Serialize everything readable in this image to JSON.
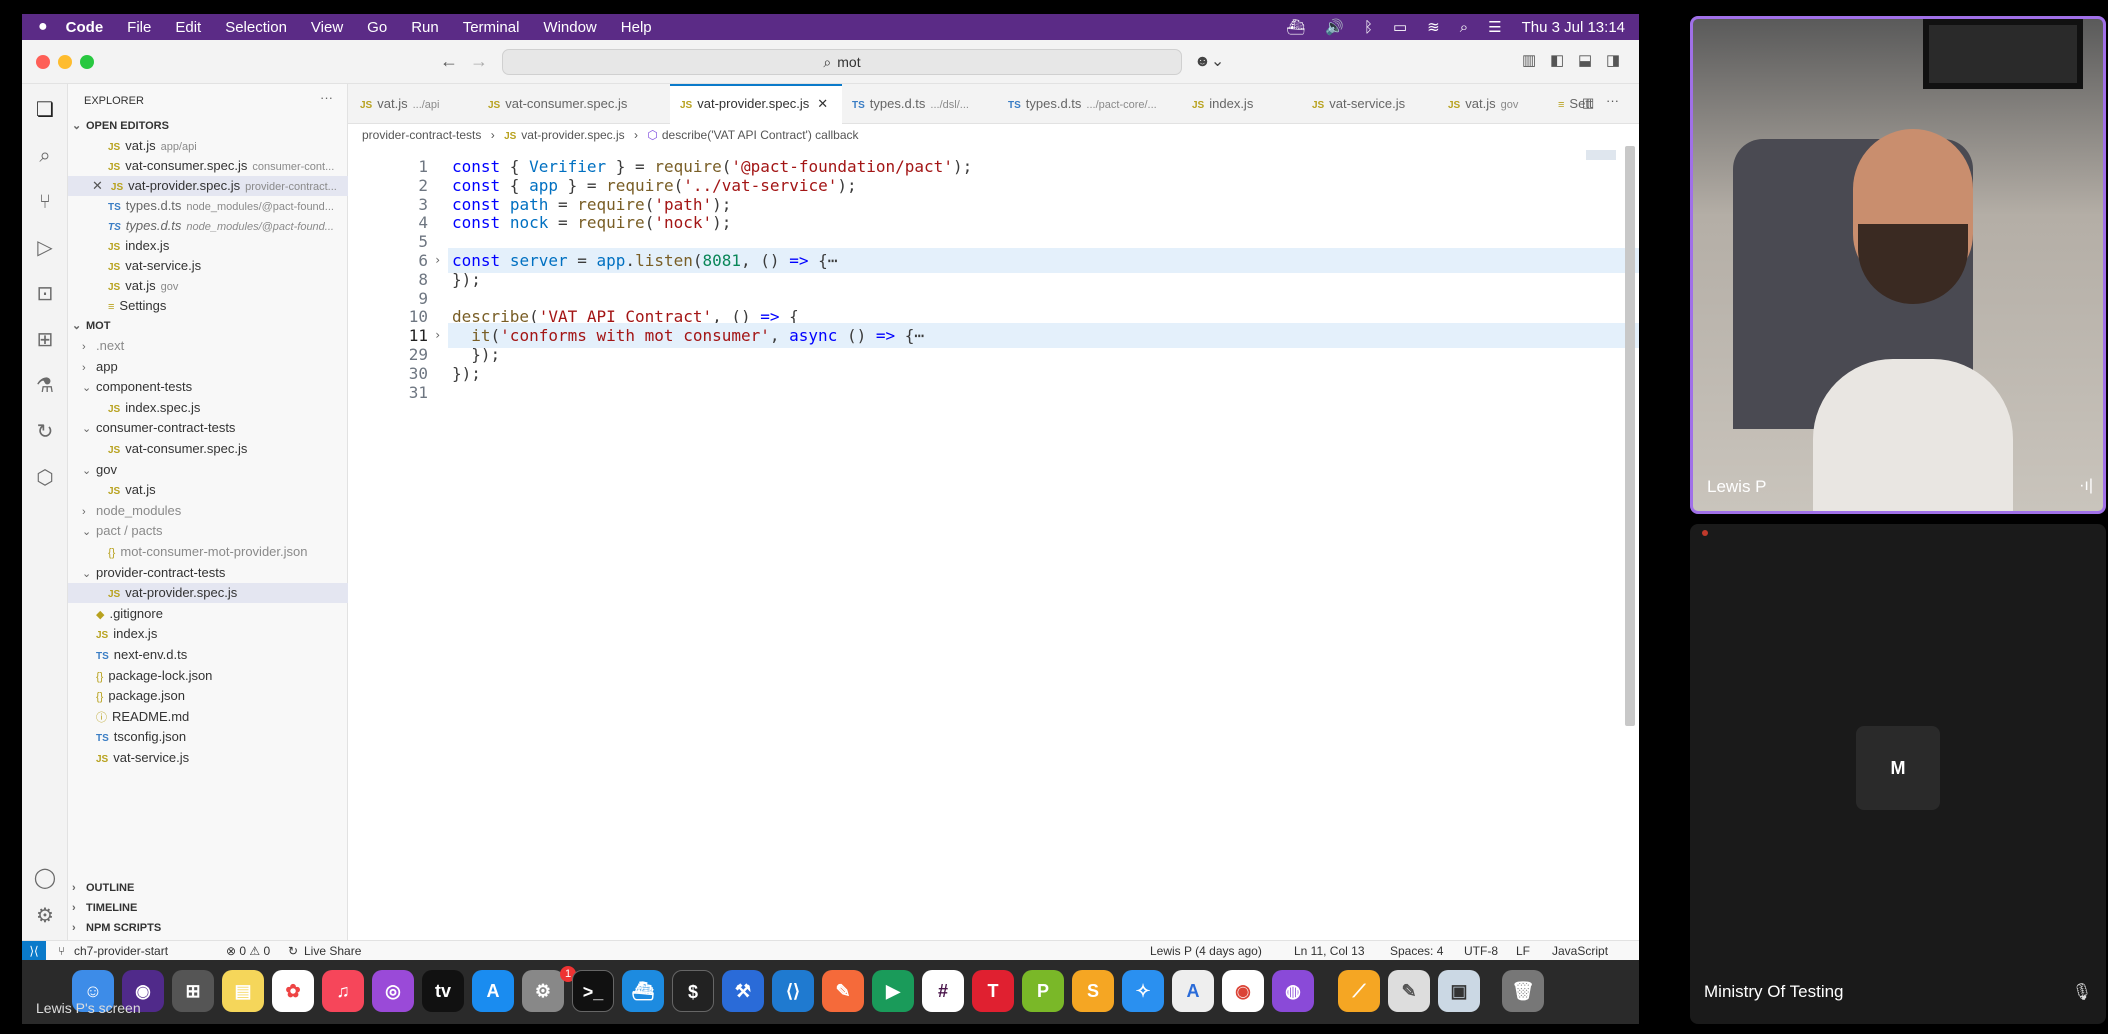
{
  "menubar": {
    "app": "Code",
    "items": [
      "File",
      "Edit",
      "Selection",
      "View",
      "Go",
      "Run",
      "Terminal",
      "Window",
      "Help"
    ],
    "clock": "Thu 3 Jul  13:14"
  },
  "search": {
    "text": "mot"
  },
  "explorer": {
    "title": "EXPLORER",
    "open_editors": "OPEN EDITORS",
    "open_files": [
      {
        "icon": "JS",
        "name": "vat.js",
        "hint": "app/api"
      },
      {
        "icon": "JS",
        "name": "vat-consumer.spec.js",
        "hint": "consumer-cont..."
      },
      {
        "icon": "JS",
        "name": "vat-provider.spec.js",
        "hint": "provider-contract..."
      },
      {
        "icon": "TS",
        "name": "types.d.ts",
        "hint": "node_modules/@pact-found..."
      },
      {
        "icon": "TS",
        "name": "types.d.ts",
        "hint": "node_modules/@pact-found..."
      },
      {
        "icon": "JS",
        "name": "index.js",
        "hint": ""
      },
      {
        "icon": "JS",
        "name": "vat-service.js",
        "hint": ""
      },
      {
        "icon": "JS",
        "name": "vat.js",
        "hint": "gov"
      },
      {
        "icon": "≡",
        "name": "Settings",
        "hint": ""
      }
    ],
    "project": "MOT",
    "tree": [
      {
        "indent": 1,
        "chev": "›",
        "icon": "",
        "name": ".next"
      },
      {
        "indent": 1,
        "chev": "›",
        "icon": "",
        "name": "app"
      },
      {
        "indent": 1,
        "chev": "⌄",
        "icon": "",
        "name": "component-tests"
      },
      {
        "indent": 2,
        "chev": "",
        "icon": "JS",
        "name": "index.spec.js"
      },
      {
        "indent": 1,
        "chev": "⌄",
        "icon": "",
        "name": "consumer-contract-tests"
      },
      {
        "indent": 2,
        "chev": "",
        "icon": "JS",
        "name": "vat-consumer.spec.js"
      },
      {
        "indent": 1,
        "chev": "⌄",
        "icon": "",
        "name": "gov"
      },
      {
        "indent": 2,
        "chev": "",
        "icon": "JS",
        "name": "vat.js"
      },
      {
        "indent": 1,
        "chev": "›",
        "icon": "",
        "name": "node_modules"
      },
      {
        "indent": 1,
        "chev": "⌄",
        "icon": "",
        "name": "pact / pacts"
      },
      {
        "indent": 2,
        "chev": "",
        "icon": "{}",
        "name": "mot-consumer-mot-provider.json"
      },
      {
        "indent": 1,
        "chev": "⌄",
        "icon": "",
        "name": "provider-contract-tests"
      },
      {
        "indent": 2,
        "chev": "",
        "icon": "JS",
        "name": "vat-provider.spec.js"
      },
      {
        "indent": 1,
        "chev": "",
        "icon": "◆",
        "name": ".gitignore"
      },
      {
        "indent": 1,
        "chev": "",
        "icon": "JS",
        "name": "index.js"
      },
      {
        "indent": 1,
        "chev": "",
        "icon": "TS",
        "name": "next-env.d.ts"
      },
      {
        "indent": 1,
        "chev": "",
        "icon": "{}",
        "name": "package-lock.json"
      },
      {
        "indent": 1,
        "chev": "",
        "icon": "{}",
        "name": "package.json"
      },
      {
        "indent": 1,
        "chev": "",
        "icon": "ⓘ",
        "name": "README.md"
      },
      {
        "indent": 1,
        "chev": "",
        "icon": "TS",
        "name": "tsconfig.json"
      },
      {
        "indent": 1,
        "chev": "",
        "icon": "JS",
        "name": "vat-service.js"
      }
    ],
    "outline": "OUTLINE",
    "timeline": "TIMELINE",
    "npm": "NPM SCRIPTS"
  },
  "tabs": [
    {
      "icon": "JS",
      "name": "vat.js",
      "hint": ".../api"
    },
    {
      "icon": "JS",
      "name": "vat-consumer.spec.js",
      "hint": ""
    },
    {
      "icon": "JS",
      "name": "vat-provider.spec.js",
      "hint": ""
    },
    {
      "icon": "TS",
      "name": "types.d.ts",
      "hint": ".../dsl/..."
    },
    {
      "icon": "TS",
      "name": "types.d.ts",
      "hint": ".../pact-core/..."
    },
    {
      "icon": "JS",
      "name": "index.js",
      "hint": ""
    },
    {
      "icon": "JS",
      "name": "vat-service.js",
      "hint": ""
    },
    {
      "icon": "JS",
      "name": "vat.js",
      "hint": "gov"
    },
    {
      "icon": "≡",
      "name": "Sett",
      "hint": ""
    }
  ],
  "breadcrumb": [
    "provider-contract-tests",
    "vat-provider.spec.js",
    "describe('VAT API Contract') callback"
  ],
  "code_lines": [
    {
      "n": "1",
      "tokens": [
        [
          "k",
          "const"
        ],
        [
          "p",
          " { "
        ],
        [
          "v",
          "Verifier"
        ],
        [
          "p",
          " } = "
        ],
        [
          "f",
          "require"
        ],
        [
          "p",
          "("
        ],
        [
          "s",
          "'@pact-foundation/pact'"
        ],
        [
          "p",
          ");"
        ]
      ]
    },
    {
      "n": "2",
      "tokens": [
        [
          "k",
          "const"
        ],
        [
          "p",
          " { "
        ],
        [
          "v",
          "app"
        ],
        [
          "p",
          " } = "
        ],
        [
          "f",
          "require"
        ],
        [
          "p",
          "("
        ],
        [
          "s",
          "'../vat-service'"
        ],
        [
          "p",
          ");"
        ]
      ]
    },
    {
      "n": "3",
      "tokens": [
        [
          "k",
          "const"
        ],
        [
          "p",
          " "
        ],
        [
          "v",
          "path"
        ],
        [
          "p",
          " = "
        ],
        [
          "f",
          "require"
        ],
        [
          "p",
          "("
        ],
        [
          "s",
          "'path'"
        ],
        [
          "p",
          ");"
        ]
      ]
    },
    {
      "n": "4",
      "tokens": [
        [
          "k",
          "const"
        ],
        [
          "p",
          " "
        ],
        [
          "v",
          "nock"
        ],
        [
          "p",
          " = "
        ],
        [
          "f",
          "require"
        ],
        [
          "p",
          "("
        ],
        [
          "s",
          "'nock'"
        ],
        [
          "p",
          ");"
        ]
      ]
    },
    {
      "n": "5",
      "tokens": []
    },
    {
      "n": "6",
      "fold": true,
      "tokens": [
        [
          "k",
          "const"
        ],
        [
          "p",
          " "
        ],
        [
          "v",
          "server"
        ],
        [
          "p",
          " = "
        ],
        [
          "v",
          "app"
        ],
        [
          "p",
          "."
        ],
        [
          "f",
          "listen"
        ],
        [
          "p",
          "("
        ],
        [
          "n",
          "8081"
        ],
        [
          "p",
          ", () "
        ],
        [
          "k",
          "=>"
        ],
        [
          "p",
          " {⋯"
        ]
      ]
    },
    {
      "n": "8",
      "tokens": [
        [
          "p",
          "});"
        ]
      ]
    },
    {
      "n": "9",
      "tokens": []
    },
    {
      "n": "10",
      "tokens": [
        [
          "f",
          "describe"
        ],
        [
          "p",
          "("
        ],
        [
          "s",
          "'VAT API Contract'"
        ],
        [
          "p",
          ", () "
        ],
        [
          "k",
          "=>"
        ],
        [
          "p",
          " {"
        ]
      ]
    },
    {
      "n": "11",
      "fold": true,
      "tokens": [
        [
          "p",
          "  "
        ],
        [
          "f",
          "it"
        ],
        [
          "p",
          "("
        ],
        [
          "s",
          "'conforms with mot consumer'"
        ],
        [
          "p",
          ", "
        ],
        [
          "k",
          "async"
        ],
        [
          "p",
          " () "
        ],
        [
          "k",
          "=>"
        ],
        [
          "p",
          " {⋯"
        ]
      ]
    },
    {
      "n": "29",
      "tokens": [
        [
          "p",
          "  });"
        ]
      ]
    },
    {
      "n": "30",
      "tokens": [
        [
          "p",
          "});"
        ]
      ]
    },
    {
      "n": "31",
      "tokens": []
    }
  ],
  "statusbar": {
    "branch": "ch7-provider-start",
    "problems": "⊗ 0 ⚠ 0",
    "liveshare": "Live Share",
    "blame": "Lewis P (4 days ago)",
    "position": "Ln 11, Col 13",
    "spaces": "Spaces: 4",
    "encoding": "UTF-8",
    "eol": "LF",
    "language": "JavaScript"
  },
  "dock": {
    "overlay_label": "Lewis P's screen",
    "badge": "1"
  },
  "participants": {
    "speaker_name": "Lewis P",
    "avatar_initial": "M",
    "other_name": "Ministry Of Testing"
  }
}
